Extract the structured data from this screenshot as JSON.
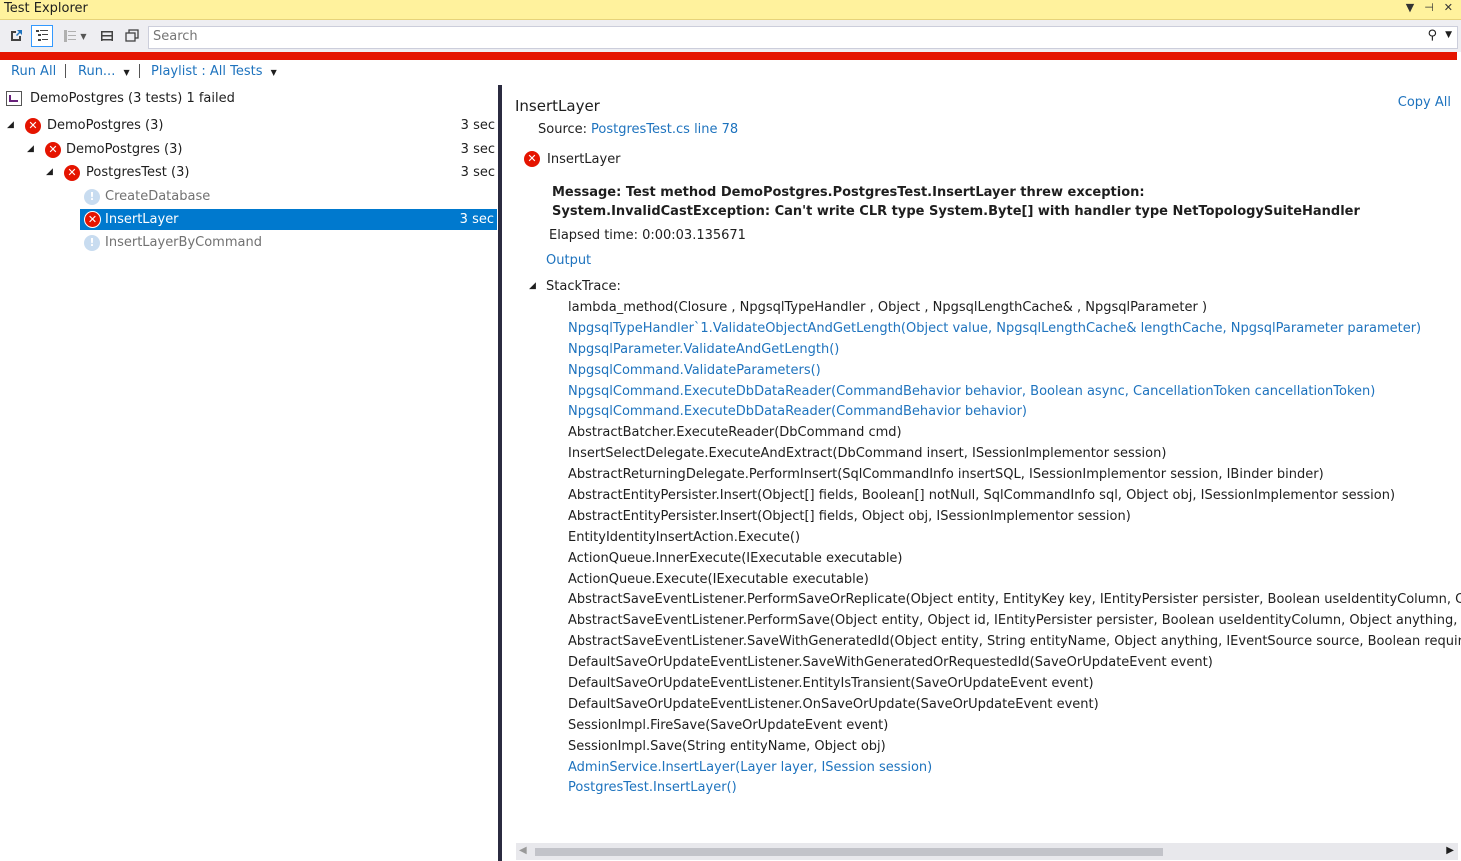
{
  "window": {
    "title": "Test Explorer"
  },
  "toolbar": {
    "icons": [
      "pin-icon",
      "hierarchy-view-icon",
      "group-by-icon",
      "columns-icon",
      "copy-icon"
    ],
    "search_placeholder": "Search"
  },
  "status": {
    "color": "#e51400",
    "state": "failed"
  },
  "commands": {
    "run_all": "Run All",
    "run": "Run...",
    "playlist": "Playlist : All Tests"
  },
  "tree": {
    "summary": "DemoPostgres (3 tests) 1 failed",
    "nodes": [
      {
        "label": "DemoPostgres (3)",
        "duration": "3 sec",
        "status": "failed"
      },
      {
        "label": "DemoPostgres (3)",
        "duration": "3 sec",
        "status": "failed"
      },
      {
        "label": "PostgresTest (3)",
        "duration": "3 sec",
        "status": "failed"
      },
      {
        "label": "CreateDatabase",
        "duration": "",
        "status": "not-run"
      },
      {
        "label": "InsertLayer",
        "duration": "3 sec",
        "status": "failed",
        "selected": true
      },
      {
        "label": "InsertLayerByCommand",
        "duration": "",
        "status": "not-run"
      }
    ]
  },
  "detail": {
    "title": "InsertLayer",
    "copy_all": "Copy All",
    "source_label": "Source:",
    "source_link": "PostgresTest.cs line 78",
    "test_name": "InsertLayer",
    "message_line1": "Message: Test method DemoPostgres.PostgresTest.InsertLayer threw exception:",
    "message_line2": "System.InvalidCastException: Can't write CLR type System.Byte[] with handler type NetTopologySuiteHandler",
    "elapsed": "Elapsed time: 0:00:03.135671",
    "output": "Output",
    "stacktrace_label": "StackTrace:",
    "stacktrace": [
      {
        "text": "lambda_method(Closure , NpgsqlTypeHandler , Object , NpgsqlLengthCache& , NpgsqlParameter )",
        "link": false
      },
      {
        "text": "NpgsqlTypeHandler`1.ValidateObjectAndGetLength(Object value, NpgsqlLengthCache& lengthCache, NpgsqlParameter parameter)",
        "link": true
      },
      {
        "text": "NpgsqlParameter.ValidateAndGetLength()",
        "link": true
      },
      {
        "text": "NpgsqlCommand.ValidateParameters()",
        "link": true
      },
      {
        "text": "NpgsqlCommand.ExecuteDbDataReader(CommandBehavior behavior, Boolean async, CancellationToken cancellationToken)",
        "link": true
      },
      {
        "text": "NpgsqlCommand.ExecuteDbDataReader(CommandBehavior behavior)",
        "link": true
      },
      {
        "text": "AbstractBatcher.ExecuteReader(DbCommand cmd)",
        "link": false
      },
      {
        "text": "InsertSelectDelegate.ExecuteAndExtract(DbCommand insert, ISessionImplementor session)",
        "link": false
      },
      {
        "text": "AbstractReturningDelegate.PerformInsert(SqlCommandInfo insertSQL, ISessionImplementor session, IBinder binder)",
        "link": false
      },
      {
        "text": "AbstractEntityPersister.Insert(Object[] fields, Boolean[] notNull, SqlCommandInfo sql, Object obj, ISessionImplementor session)",
        "link": false
      },
      {
        "text": "AbstractEntityPersister.Insert(Object[] fields, Object obj, ISessionImplementor session)",
        "link": false
      },
      {
        "text": "EntityIdentityInsertAction.Execute()",
        "link": false
      },
      {
        "text": "ActionQueue.InnerExecute(IExecutable executable)",
        "link": false
      },
      {
        "text": "ActionQueue.Execute(IExecutable executable)",
        "link": false
      },
      {
        "text": "AbstractSaveEventListener.PerformSaveOrReplicate(Object entity, EntityKey key, IEntityPersister persister, Boolean useIdentityColumn, Object any",
        "link": false
      },
      {
        "text": "AbstractSaveEventListener.PerformSave(Object entity, Object id, IEntityPersister persister, Boolean useIdentityColumn, Object anything, IEventSou",
        "link": false
      },
      {
        "text": "AbstractSaveEventListener.SaveWithGeneratedId(Object entity, String entityName, Object anything, IEventSource source, Boolean requiresImmed",
        "link": false
      },
      {
        "text": "DefaultSaveOrUpdateEventListener.SaveWithGeneratedOrRequestedId(SaveOrUpdateEvent event)",
        "link": false
      },
      {
        "text": "DefaultSaveOrUpdateEventListener.EntityIsTransient(SaveOrUpdateEvent event)",
        "link": false
      },
      {
        "text": "DefaultSaveOrUpdateEventListener.OnSaveOrUpdate(SaveOrUpdateEvent event)",
        "link": false
      },
      {
        "text": "SessionImpl.FireSave(SaveOrUpdateEvent event)",
        "link": false
      },
      {
        "text": "SessionImpl.Save(String entityName, Object obj)",
        "link": false
      },
      {
        "text": "AdminService.InsertLayer(Layer layer, ISession session)",
        "link": true
      },
      {
        "text": "PostgresTest.InsertLayer()",
        "link": true
      }
    ]
  }
}
